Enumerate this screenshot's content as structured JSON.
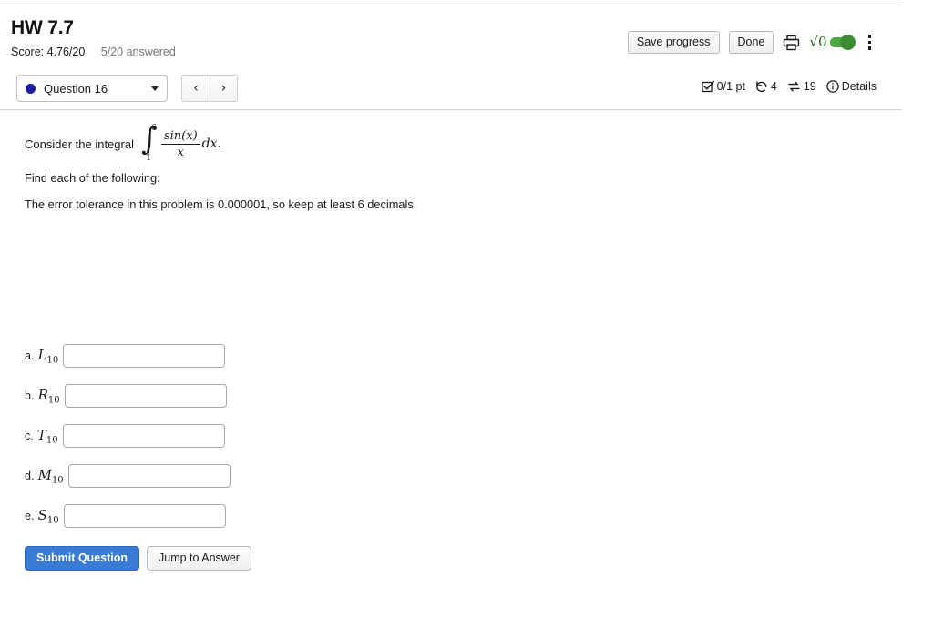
{
  "header": {
    "title": "HW 7.7",
    "score_label": "Score: 4.76/20",
    "answered_label": "5/20 answered"
  },
  "toolbar": {
    "save_label": "Save progress",
    "done_label": "Done",
    "print_icon": "printer-icon",
    "math_icon": "sqrt-zero-icon",
    "math_glyph": "√0",
    "math_toggle_state": "on",
    "menu_icon": "kebab-menu-icon"
  },
  "question_bar": {
    "selected_question": "Question 16",
    "status_dot_color": "#1c1ca0",
    "prev_label": "‹",
    "next_label": "›",
    "status": {
      "points": "0/1 pt",
      "attempts": "4",
      "versions": "19",
      "details_label": "Details"
    }
  },
  "question": {
    "prompt_prefix": "Consider the integral",
    "integral": {
      "sign": "∫",
      "upper_limit": "6",
      "lower_limit": "1",
      "numerator": "sin(x)",
      "denominator": "x",
      "differential": "dx.",
      "latex": "\\int_{1}^{6} \\frac{\\sin(x)}{x}\\,dx."
    },
    "find_line": "Find each of the following:",
    "tolerance_line": "The error tolerance in this problem is 0.000001, so keep at least 6 decimals.",
    "answers": [
      {
        "letter": "a.",
        "symbol": "L",
        "subscript": "10",
        "value": "",
        "placeholder": ""
      },
      {
        "letter": "b.",
        "symbol": "R",
        "subscript": "10",
        "value": "",
        "placeholder": ""
      },
      {
        "letter": "c.",
        "symbol": "T",
        "subscript": "10",
        "value": "",
        "placeholder": ""
      },
      {
        "letter": "d.",
        "symbol": "M",
        "subscript": "10",
        "value": "",
        "placeholder": ""
      },
      {
        "letter": "e.",
        "symbol": "S",
        "subscript": "10",
        "value": "",
        "placeholder": ""
      }
    ]
  },
  "actions": {
    "submit_label": "Submit Question",
    "jump_label": "Jump to Answer"
  },
  "colors": {
    "submit_blue": "#3a7bd5",
    "toggle_green": "#4aa93f",
    "math_green": "#1d6b1d",
    "dot_navy": "#1c1ca0",
    "muted_text": "#767676"
  }
}
